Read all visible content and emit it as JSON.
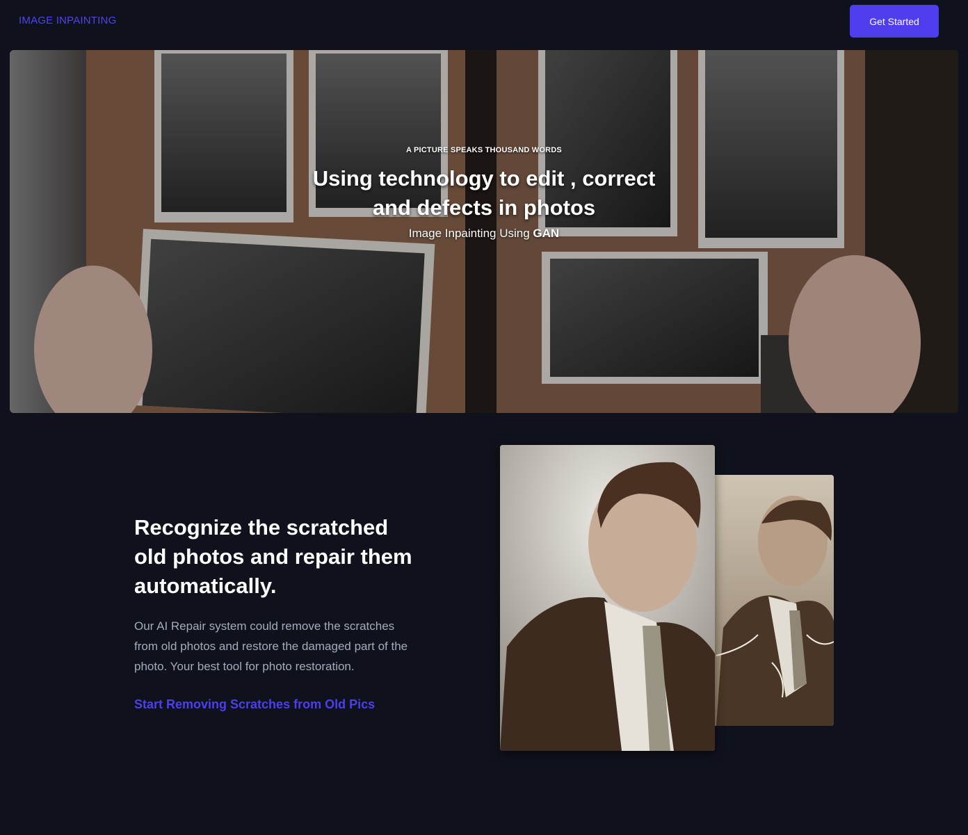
{
  "header": {
    "brand": "IMAGE INPAINTING",
    "cta_label": "Get Started"
  },
  "hero": {
    "eyebrow": "A PICTURE SPEAKS THOUSAND WORDS",
    "title_line1": "Using technology to edit , correct",
    "title_line2": "and defects in photos",
    "subtitle_prefix": "Image Inpainting Using ",
    "subtitle_emphasis": "GAN"
  },
  "feature": {
    "title_line1": "Recognize the scratched",
    "title_line2": "old photos and repair them",
    "title_line3": "automatically.",
    "desc_line1": "Our AI Repair system could remove the scratches",
    "desc_line2": "from old photos and restore the damaged part of the",
    "desc_line3": "photo. Your best tool for photo restoration.",
    "link_label": "Start Removing Scratches from Old Pics"
  },
  "colors": {
    "background": "#0f121c",
    "accent": "#4f3df0",
    "muted_text": "#a7abb7"
  }
}
